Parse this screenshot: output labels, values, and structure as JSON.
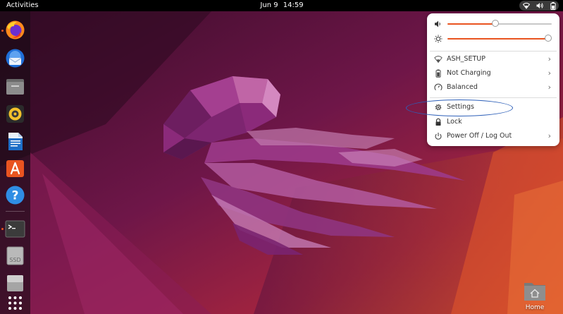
{
  "topbar": {
    "activities_label": "Activities",
    "date": "Jun 9",
    "time": "14:59",
    "status_icons": [
      "wifi-icon",
      "volume-icon",
      "battery-icon"
    ]
  },
  "dock": {
    "apps": [
      {
        "name": "Firefox",
        "icon": "firefox-icon",
        "running": true
      },
      {
        "name": "Thunderbird Mail",
        "icon": "thunderbird-icon",
        "running": false
      },
      {
        "name": "Files",
        "icon": "files-icon",
        "running": false
      },
      {
        "name": "Rhythmbox",
        "icon": "rhythmbox-icon",
        "running": false
      },
      {
        "name": "LibreOffice Writer",
        "icon": "writer-icon",
        "running": false
      },
      {
        "name": "Ubuntu Software",
        "icon": "software-icon",
        "running": false
      },
      {
        "name": "Help",
        "icon": "help-icon",
        "running": false
      },
      {
        "name": "Terminal",
        "icon": "terminal-icon",
        "running": true
      },
      {
        "name": "SSD",
        "icon": "ssd-drive-icon",
        "label": "SSD",
        "running": false
      },
      {
        "name": "Drive",
        "icon": "drive-icon",
        "running": false
      },
      {
        "name": "Show Applications",
        "icon": "app-grid-icon",
        "running": false
      }
    ]
  },
  "desktop": {
    "home_label": "Home"
  },
  "quick_settings": {
    "volume": {
      "icon": "volume-icon",
      "level": 0.46
    },
    "brightness": {
      "icon": "brightness-icon",
      "level": 1.0
    },
    "items": [
      {
        "label": "ASH_SETUP",
        "icon": "wifi-icon",
        "submenu": true
      },
      {
        "label": "Not Charging",
        "icon": "battery-icon",
        "submenu": true
      },
      {
        "label": "Balanced",
        "icon": "power-mode-icon",
        "submenu": true
      },
      {
        "label": "Settings",
        "icon": "gear-icon",
        "submenu": false
      },
      {
        "label": "Lock",
        "icon": "lock-icon",
        "submenu": false
      },
      {
        "label": "Power Off / Log Out",
        "icon": "power-icon",
        "submenu": true
      }
    ],
    "chevron": "›"
  },
  "colors": {
    "accent": "#e95420",
    "annotation": "#2d5fb8",
    "menu_bg": "#ffffff"
  }
}
